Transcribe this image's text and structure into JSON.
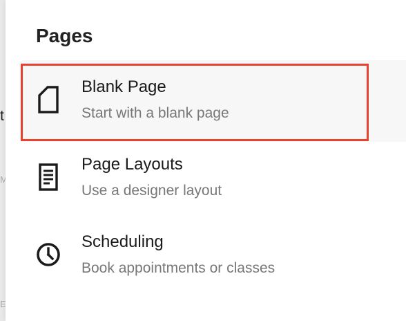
{
  "backdrop": {
    "fragment_1": "t",
    "fragment_2": "M",
    "fragment_3": "E"
  },
  "panel": {
    "title": "Pages",
    "items": [
      {
        "label": "Blank Page",
        "description": "Start with a blank page",
        "icon": "blank-page-icon",
        "selected": true
      },
      {
        "label": "Page Layouts",
        "description": "Use a designer layout",
        "icon": "page-layouts-icon",
        "selected": false
      },
      {
        "label": "Scheduling",
        "description": "Book appointments or classes",
        "icon": "clock-icon",
        "selected": false
      }
    ]
  },
  "colors": {
    "selection_border": "#e8412d",
    "hover_background": "#f7f7f7",
    "text_primary": "#1a1a1a",
    "text_secondary": "#777777"
  }
}
